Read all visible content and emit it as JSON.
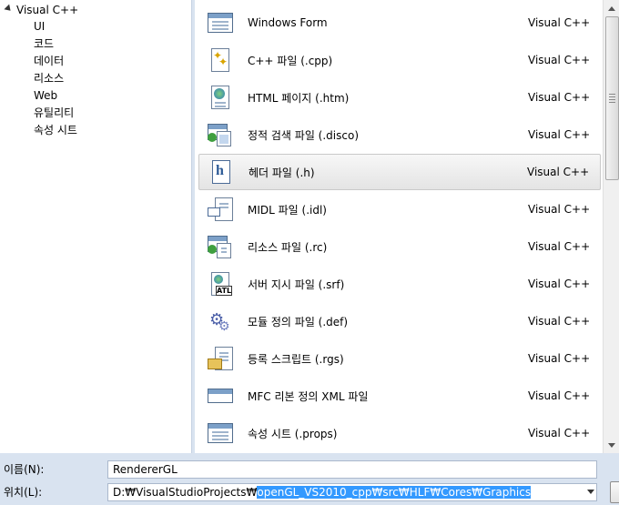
{
  "tree": {
    "root": "Visual C++",
    "items": [
      "UI",
      "코드",
      "데이터",
      "리소스",
      "Web",
      "유틸리티",
      "속성 시트"
    ]
  },
  "templates": [
    {
      "name": "Windows Form",
      "lang": "Visual C++",
      "icon": "windows-form-icon"
    },
    {
      "name": "C++ 파일 (.cpp)",
      "lang": "Visual C++",
      "icon": "cpp-file-icon"
    },
    {
      "name": "HTML 페이지 (.htm)",
      "lang": "Visual C++",
      "icon": "html-page-icon"
    },
    {
      "name": "정적 검색 파일 (.disco)",
      "lang": "Visual C++",
      "icon": "disco-file-icon"
    },
    {
      "name": "헤더 파일 (.h)",
      "lang": "Visual C++",
      "icon": "header-file-icon"
    },
    {
      "name": "MIDL 파일 (.idl)",
      "lang": "Visual C++",
      "icon": "midl-file-icon"
    },
    {
      "name": "리소스 파일 (.rc)",
      "lang": "Visual C++",
      "icon": "resource-file-icon"
    },
    {
      "name": "서버 지시 파일 (.srf)",
      "lang": "Visual C++",
      "icon": "srf-file-icon"
    },
    {
      "name": "모듈 정의 파일 (.def)",
      "lang": "Visual C++",
      "icon": "def-file-icon"
    },
    {
      "name": "등록 스크립트 (.rgs)",
      "lang": "Visual C++",
      "icon": "rgs-file-icon"
    },
    {
      "name": "MFC 리본 정의 XML 파일",
      "lang": "Visual C++",
      "icon": "ribbon-xml-icon"
    },
    {
      "name": "속성 시트 (.props)",
      "lang": "Visual C++",
      "icon": "props-file-icon"
    }
  ],
  "selected_index": 4,
  "form": {
    "name_label": "이름(N):",
    "name_value": "RendererGL",
    "location_label": "위치(L):",
    "location_prefix": "D:₩VisualStudioProjects₩",
    "location_selected": "openGL_VS2010_cpp₩src₩HLF₩Cores₩Graphics"
  },
  "colors": {
    "selection_highlight": "#3399ff",
    "panel_bg": "#d9e3f0"
  }
}
